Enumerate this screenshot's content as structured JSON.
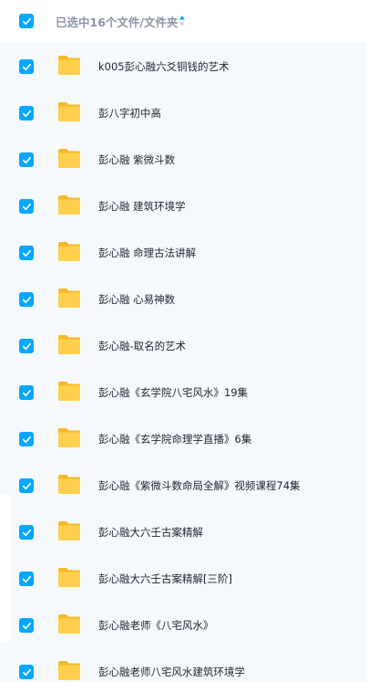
{
  "header": {
    "selection_text": "已选中16个文件/文件夹"
  },
  "files": [
    {
      "name": "k005彭心融六爻铜钱的艺术"
    },
    {
      "name": "彭八字初中高"
    },
    {
      "name": "彭心融 紫微斗数"
    },
    {
      "name": "彭心融 建筑环境学"
    },
    {
      "name": "彭心融 命理古法讲解"
    },
    {
      "name": "彭心融 心易神数"
    },
    {
      "name": "彭心融-取名的艺术"
    },
    {
      "name": "彭心融《玄学院八宅风水》19集"
    },
    {
      "name": "彭心融《玄学院命理学直播》6集"
    },
    {
      "name": "彭心融《紫微斗数命局全解》视频课程74集"
    },
    {
      "name": "彭心融大六壬古案精解"
    },
    {
      "name": "彭心融大六壬古案精解[三阶]"
    },
    {
      "name": "彭心融老师《八宅风水》"
    },
    {
      "name": "彭心融老师八宅风水建筑环境学"
    }
  ],
  "colors": {
    "checkbox": "#06a7ff",
    "folder": "#ffc83d",
    "text": "#1d2433",
    "header_text": "#8a95a5"
  }
}
